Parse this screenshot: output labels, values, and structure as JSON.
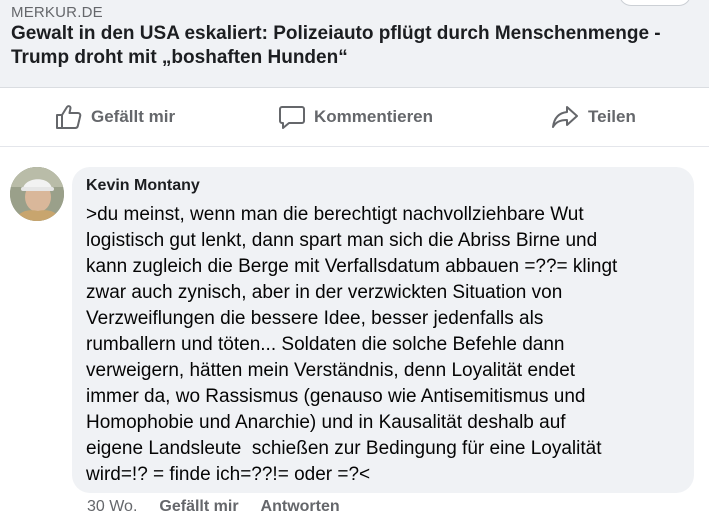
{
  "link_preview": {
    "source": "MERKUR.DE",
    "headline": "Gewalt in den USA eskaliert: Polizeiauto pflügt durch Menschenmenge - Trump droht mit „boshaften Hunden“"
  },
  "actions": {
    "like_label": "Gefällt mir",
    "comment_label": "Kommentieren",
    "share_label": "Teilen",
    "like_icon": "thumbs-up-icon",
    "comment_icon": "speech-bubble-icon",
    "share_icon": "share-arrow-icon"
  },
  "comment": {
    "author": "Kevin Montany",
    "text": ">du meinst, wenn man die berechtigt nachvollziehbare Wut\nlogistisch gut lenkt, dann spart man sich die Abriss Birne und\nkann zugleich die Berge mit Verfallsdatum abbauen =??= klingt\nzwar auch zynisch, aber in der verzwickten Situation von\nVerzweiflungen die bessere Idee, besser jedenfalls als\nrumballern und töten... Soldaten die solche Befehle dann\nverweigern, hätten mein Verständnis, denn Loyalität endet\nimmer da, wo Rassismus (genauso wie Antisemitismus und\nHomophobie und Anarchie) und in Kausalität deshalb auf\neigene Landsleute  schießen zur Bedingung für eine Loyalität\nwird=!? = finde ich=??!= oder =?<",
    "time": "30 Wo.",
    "like_label": "Gefällt mir",
    "reply_label": "Antworten"
  },
  "colors": {
    "card_bg": "#f0f2f5",
    "muted_text": "#65676b",
    "text": "#1c1e21"
  }
}
